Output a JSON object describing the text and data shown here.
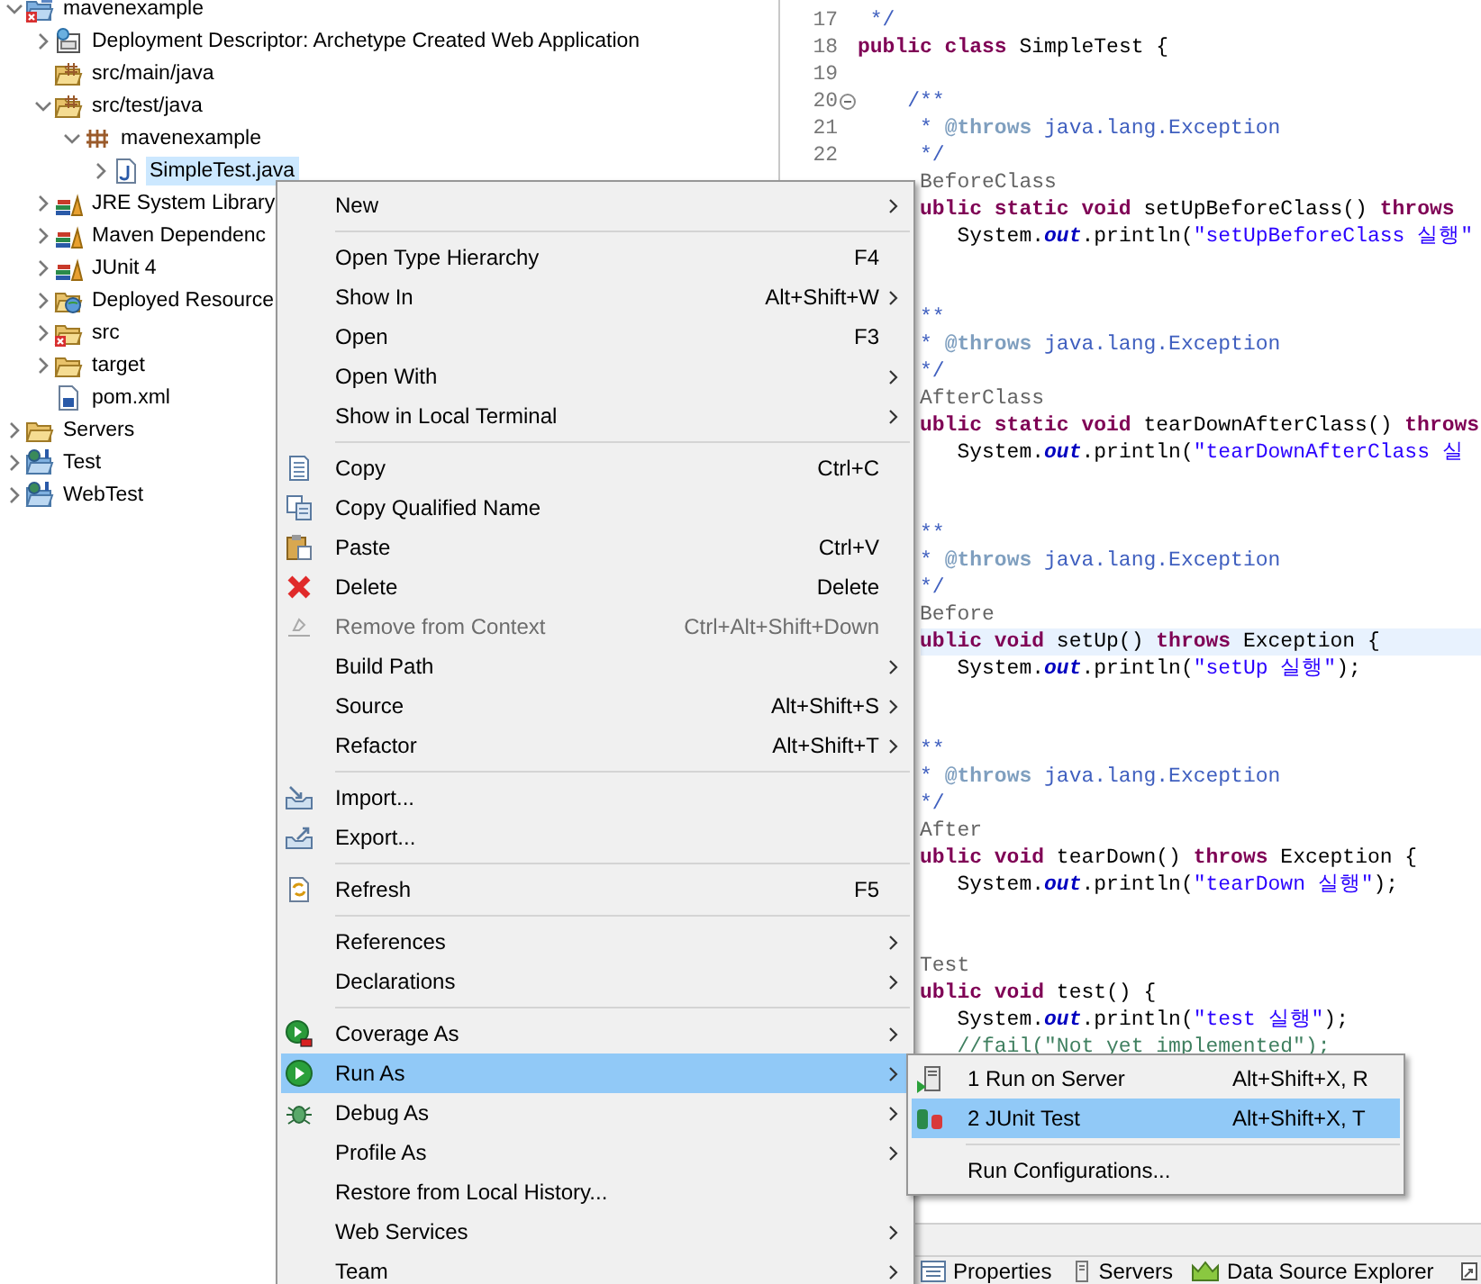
{
  "project_explorer": {
    "items": [
      {
        "label": "mavenexample",
        "kind": "broken",
        "expanded": true,
        "selected": false,
        "children": [
          {
            "label": "Deployment Descriptor: Archetype Created Web Application",
            "kind": "descriptor",
            "expanded": false,
            "selected": false
          },
          {
            "label": "src/main/java",
            "kind": "source",
            "selected": false
          },
          {
            "label": "src/test/java",
            "kind": "source",
            "expanded": true,
            "selected": false,
            "children": [
              {
                "label": "mavenexample",
                "kind": "package",
                "expanded": true,
                "selected": false,
                "children": [
                  {
                    "label": "SimpleTest.java",
                    "kind": "java",
                    "expanded": false,
                    "selected": true
                  }
                ]
              }
            ]
          },
          {
            "label": "JRE System Library",
            "kind": "library",
            "expanded": false,
            "selected": false
          },
          {
            "label": "Maven Dependenc",
            "kind": "library",
            "expanded": false,
            "selected": false
          },
          {
            "label": "JUnit 4",
            "kind": "library",
            "expanded": false,
            "selected": false
          },
          {
            "label": "Deployed Resource",
            "kind": "resources",
            "expanded": false,
            "selected": false
          },
          {
            "label": "src",
            "kind": "errorfolder",
            "expanded": false,
            "selected": false
          },
          {
            "label": "target",
            "kind": "folder",
            "expanded": false,
            "selected": false
          },
          {
            "label": "pom.xml",
            "kind": "pom",
            "selected": false
          }
        ]
      },
      {
        "label": "Servers",
        "kind": "folder",
        "expanded": false,
        "selected": false
      },
      {
        "label": "Test",
        "kind": "project",
        "expanded": false,
        "selected": false
      },
      {
        "label": "WebTest",
        "kind": "project",
        "expanded": false,
        "selected": false
      }
    ]
  },
  "editor": {
    "lines": [
      {
        "kind": "full",
        "number": "17",
        "tokens": [
          {
            "kind": "doc",
            "text": " */"
          }
        ]
      },
      {
        "kind": "full",
        "number": "18",
        "tokens": [
          {
            "kind": "keyword",
            "text": "public class"
          },
          {
            "kind": "plain",
            "text": " SimpleTest {"
          }
        ]
      },
      {
        "kind": "full",
        "number": "19"
      },
      {
        "kind": "full",
        "number": "20",
        "fold": true,
        "tokens": [
          {
            "kind": "doc",
            "text": "    /**"
          }
        ]
      },
      {
        "kind": "full",
        "number": "21",
        "tokens": [
          {
            "kind": "doc",
            "text": "     * "
          },
          {
            "kind": "tag",
            "text": "@throws"
          },
          {
            "kind": "doc",
            "text": " java.lang.Exception"
          }
        ]
      },
      {
        "kind": "full",
        "number": "22",
        "tokens": [
          {
            "kind": "doc",
            "text": "     */"
          }
        ]
      },
      {
        "kind": "partial",
        "tokens": [
          {
            "kind": "annotation",
            "text": "BeforeClass"
          }
        ]
      },
      {
        "kind": "partial",
        "tokens": [
          {
            "kind": "keyword",
            "text": "ublic static void"
          },
          {
            "kind": "plain",
            "text": " setUpBeforeClass() "
          },
          {
            "kind": "keyword",
            "text": "throws"
          }
        ]
      },
      {
        "kind": "partial",
        "tokens": [
          {
            "kind": "plain",
            "text": "   System."
          },
          {
            "kind": "field",
            "text": "out"
          },
          {
            "kind": "plain",
            "text": ".println("
          },
          {
            "kind": "string",
            "text": "\"setUpBeforeClass 실행\""
          }
        ]
      },
      {
        "kind": "blank"
      },
      {
        "kind": "blank"
      },
      {
        "kind": "partial",
        "tokens": [
          {
            "kind": "doc",
            "text": "**"
          }
        ]
      },
      {
        "kind": "partial",
        "tokens": [
          {
            "kind": "doc",
            "text": "* "
          },
          {
            "kind": "tag",
            "text": "@throws"
          },
          {
            "kind": "doc",
            "text": " java.lang.Exception"
          }
        ]
      },
      {
        "kind": "partial",
        "tokens": [
          {
            "kind": "doc",
            "text": "*/"
          }
        ]
      },
      {
        "kind": "partial",
        "tokens": [
          {
            "kind": "annotation",
            "text": "AfterClass"
          }
        ]
      },
      {
        "kind": "partial",
        "tokens": [
          {
            "kind": "keyword",
            "text": "ublic static void"
          },
          {
            "kind": "plain",
            "text": " tearDownAfterClass() "
          },
          {
            "kind": "keyword",
            "text": "throws"
          }
        ]
      },
      {
        "kind": "partial",
        "tokens": [
          {
            "kind": "plain",
            "text": "   System."
          },
          {
            "kind": "field",
            "text": "out"
          },
          {
            "kind": "plain",
            "text": ".println("
          },
          {
            "kind": "string",
            "text": "\"tearDownAfterClass 실"
          }
        ]
      },
      {
        "kind": "blank"
      },
      {
        "kind": "blank"
      },
      {
        "kind": "partial",
        "tokens": [
          {
            "kind": "doc",
            "text": "**"
          }
        ]
      },
      {
        "kind": "partial",
        "tokens": [
          {
            "kind": "doc",
            "text": "* "
          },
          {
            "kind": "tag",
            "text": "@throws"
          },
          {
            "kind": "doc",
            "text": " java.lang.Exception"
          }
        ]
      },
      {
        "kind": "partial",
        "tokens": [
          {
            "kind": "doc",
            "text": "*/"
          }
        ]
      },
      {
        "kind": "partial",
        "tokens": [
          {
            "kind": "annotation",
            "text": "Before"
          }
        ]
      },
      {
        "kind": "partial",
        "current": true,
        "tokens": [
          {
            "kind": "keyword",
            "text": "ublic void"
          },
          {
            "kind": "plain",
            "text": " setUp() "
          },
          {
            "kind": "keyword",
            "text": "throws"
          },
          {
            "kind": "plain",
            "text": " Exception {"
          }
        ]
      },
      {
        "kind": "partial",
        "tokens": [
          {
            "kind": "plain",
            "text": "   System."
          },
          {
            "kind": "field",
            "text": "out"
          },
          {
            "kind": "plain",
            "text": ".println("
          },
          {
            "kind": "string",
            "text": "\"setUp 실행\""
          },
          {
            "kind": "plain",
            "text": ");"
          }
        ]
      },
      {
        "kind": "blank"
      },
      {
        "kind": "blank"
      },
      {
        "kind": "partial",
        "tokens": [
          {
            "kind": "doc",
            "text": "**"
          }
        ]
      },
      {
        "kind": "partial",
        "tokens": [
          {
            "kind": "doc",
            "text": "* "
          },
          {
            "kind": "tag",
            "text": "@throws"
          },
          {
            "kind": "doc",
            "text": " java.lang.Exception"
          }
        ]
      },
      {
        "kind": "partial",
        "tokens": [
          {
            "kind": "doc",
            "text": "*/"
          }
        ]
      },
      {
        "kind": "partial",
        "tokens": [
          {
            "kind": "annotation",
            "text": "After"
          }
        ]
      },
      {
        "kind": "partial",
        "tokens": [
          {
            "kind": "keyword",
            "text": "ublic void"
          },
          {
            "kind": "plain",
            "text": " tearDown() "
          },
          {
            "kind": "keyword",
            "text": "throws"
          },
          {
            "kind": "plain",
            "text": " Exception {"
          }
        ]
      },
      {
        "kind": "partial",
        "tokens": [
          {
            "kind": "plain",
            "text": "   System."
          },
          {
            "kind": "field",
            "text": "out"
          },
          {
            "kind": "plain",
            "text": ".println("
          },
          {
            "kind": "string",
            "text": "\"tearDown 실행\""
          },
          {
            "kind": "plain",
            "text": ");"
          }
        ]
      },
      {
        "kind": "blank"
      },
      {
        "kind": "blank"
      },
      {
        "kind": "partial",
        "tokens": [
          {
            "kind": "annotation",
            "text": "Test"
          }
        ]
      },
      {
        "kind": "partial",
        "tokens": [
          {
            "kind": "keyword",
            "text": "ublic void"
          },
          {
            "kind": "plain",
            "text": " test() {"
          }
        ]
      },
      {
        "kind": "partial",
        "tokens": [
          {
            "kind": "plain",
            "text": "   System."
          },
          {
            "kind": "field",
            "text": "out"
          },
          {
            "kind": "plain",
            "text": ".println("
          },
          {
            "kind": "string",
            "text": "\"test 실행\""
          },
          {
            "kind": "plain",
            "text": ");"
          }
        ]
      },
      {
        "kind": "partial",
        "tokens": [
          {
            "kind": "comment",
            "text": "   //fail(\"Not yet implemented\");"
          }
        ]
      }
    ]
  },
  "bottom_tabs": [
    {
      "label": "Properties",
      "kind": "properties"
    },
    {
      "label": "Servers",
      "kind": "servers"
    },
    {
      "label": "Data Source Explorer",
      "kind": "datasource"
    }
  ],
  "context_menu": {
    "items": [
      {
        "kind": "plain",
        "label": "New",
        "submenu": true,
        "disabled": false,
        "selected": false
      },
      {
        "kind": "separator"
      },
      {
        "kind": "plain",
        "label": "Open Type Hierarchy",
        "shortcut": "F4",
        "submenu": false,
        "disabled": false,
        "selected": false
      },
      {
        "kind": "plain",
        "label": "Show In",
        "shortcut": "Alt+Shift+W",
        "submenu": true,
        "disabled": false,
        "selected": false
      },
      {
        "kind": "plain",
        "label": "Open",
        "shortcut": "F3",
        "submenu": false,
        "disabled": false,
        "selected": false
      },
      {
        "kind": "plain",
        "label": "Open With",
        "submenu": true,
        "disabled": false,
        "selected": false
      },
      {
        "kind": "plain",
        "label": "Show in Local Terminal",
        "submenu": true,
        "disabled": false,
        "selected": false
      },
      {
        "kind": "separator"
      },
      {
        "kind": "copy",
        "label": "Copy",
        "shortcut": "Ctrl+C",
        "submenu": false,
        "disabled": false,
        "selected": false
      },
      {
        "kind": "copyname",
        "label": "Copy Qualified Name",
        "submenu": false,
        "disabled": false,
        "selected": false
      },
      {
        "kind": "paste",
        "label": "Paste",
        "shortcut": "Ctrl+V",
        "submenu": false,
        "disabled": false,
        "selected": false
      },
      {
        "kind": "delete",
        "label": "Delete",
        "shortcut": "Delete",
        "submenu": false,
        "disabled": false,
        "selected": false
      },
      {
        "kind": "remove",
        "label": "Remove from Context",
        "shortcut": "Ctrl+Alt+Shift+Down",
        "submenu": false,
        "disabled": true,
        "selected": false
      },
      {
        "kind": "plain",
        "label": "Build Path",
        "submenu": true,
        "disabled": false,
        "selected": false
      },
      {
        "kind": "plain",
        "label": "Source",
        "shortcut": "Alt+Shift+S",
        "submenu": true,
        "disabled": false,
        "selected": false
      },
      {
        "kind": "plain",
        "label": "Refactor",
        "shortcut": "Alt+Shift+T",
        "submenu": true,
        "disabled": false,
        "selected": false
      },
      {
        "kind": "separator"
      },
      {
        "kind": "import",
        "label": "Import...",
        "submenu": false,
        "disabled": false,
        "selected": false
      },
      {
        "kind": "export",
        "label": "Export...",
        "submenu": false,
        "disabled": false,
        "selected": false
      },
      {
        "kind": "separator"
      },
      {
        "kind": "refresh",
        "label": "Refresh",
        "shortcut": "F5",
        "submenu": false,
        "disabled": false,
        "selected": false
      },
      {
        "kind": "separator"
      },
      {
        "kind": "plain",
        "label": "References",
        "submenu": true,
        "disabled": false,
        "selected": false
      },
      {
        "kind": "plain",
        "label": "Declarations",
        "submenu": true,
        "disabled": false,
        "selected": false
      },
      {
        "kind": "separator"
      },
      {
        "kind": "coverage",
        "label": "Coverage As",
        "submenu": true,
        "disabled": false,
        "selected": false
      },
      {
        "kind": "run",
        "label": "Run As",
        "submenu": true,
        "disabled": false,
        "selected": true
      },
      {
        "kind": "debug",
        "label": "Debug As",
        "submenu": true,
        "disabled": false,
        "selected": false
      },
      {
        "kind": "plain",
        "label": "Profile As",
        "submenu": true,
        "disabled": false,
        "selected": false
      },
      {
        "kind": "plain",
        "label": "Restore from Local History...",
        "submenu": false,
        "disabled": false,
        "selected": false
      },
      {
        "kind": "plain",
        "label": "Web Services",
        "submenu": true,
        "disabled": false,
        "selected": false
      },
      {
        "kind": "plain",
        "label": "Team",
        "submenu": true,
        "disabled": false,
        "selected": false
      }
    ]
  },
  "run_as_submenu": {
    "items": [
      {
        "kind": "server",
        "label": "1 Run on Server",
        "shortcut": "Alt+Shift+X, R",
        "disabled": false,
        "selected": false
      },
      {
        "kind": "junit",
        "label": "2 JUnit Test",
        "shortcut": "Alt+Shift+X, T",
        "disabled": false,
        "selected": true
      },
      {
        "kind": "separator"
      },
      {
        "kind": "plain",
        "label": "Run Configurations...",
        "disabled": false,
        "selected": false
      }
    ]
  }
}
